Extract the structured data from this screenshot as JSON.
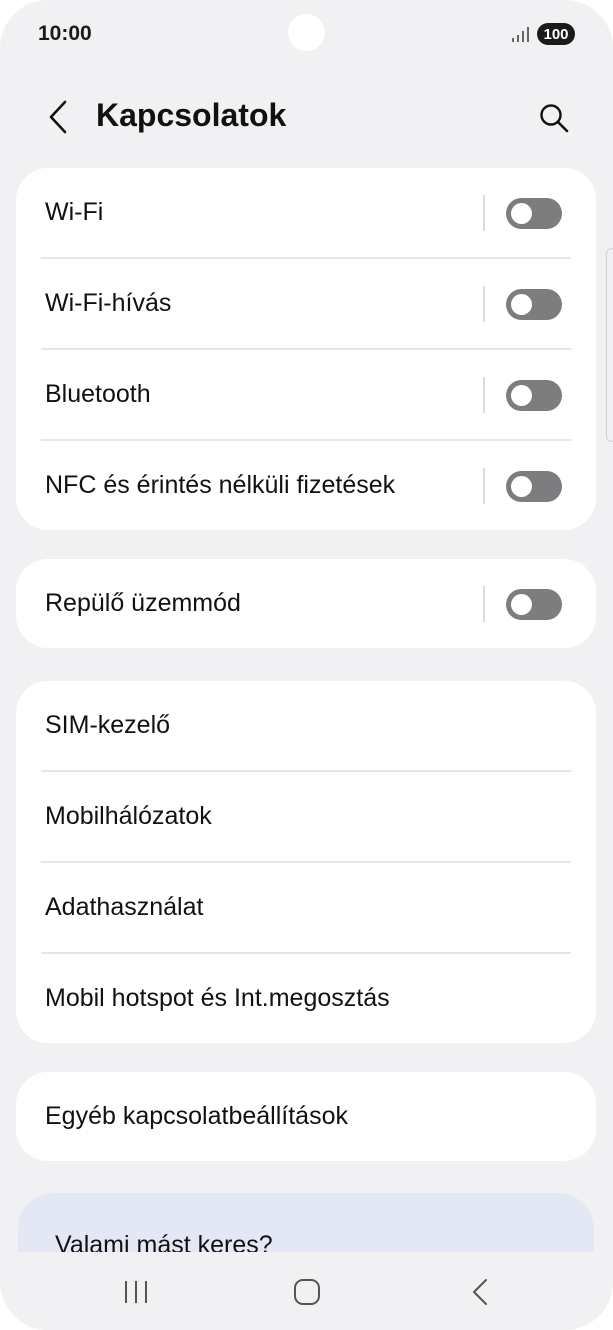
{
  "status": {
    "time": "10:00",
    "battery": "100"
  },
  "header": {
    "title": "Kapcsolatok"
  },
  "group1": [
    {
      "label": "Wi-Fi",
      "toggle_on": false
    },
    {
      "label": "Wi-Fi-hívás",
      "toggle_on": false
    },
    {
      "label": "Bluetooth",
      "toggle_on": false
    },
    {
      "label": "NFC és érintés nélküli fizetések",
      "toggle_on": false
    }
  ],
  "group2": [
    {
      "label": "Repülő üzemmód",
      "toggle_on": false
    }
  ],
  "group3": [
    {
      "label": "SIM-kezelő"
    },
    {
      "label": "Mobilhálózatok"
    },
    {
      "label": "Adathasználat"
    },
    {
      "label": "Mobil hotspot és Int.megosztás"
    }
  ],
  "group4": [
    {
      "label": "Egyéb kapcsolatbeállítások"
    }
  ],
  "suggestion": {
    "text": "Valami mást keres?"
  },
  "colors": {
    "toggle_off": "#7d7d7f",
    "background": "#f1f1f3",
    "card": "#ffffff",
    "suggestion_card": "#e4e8f4"
  }
}
